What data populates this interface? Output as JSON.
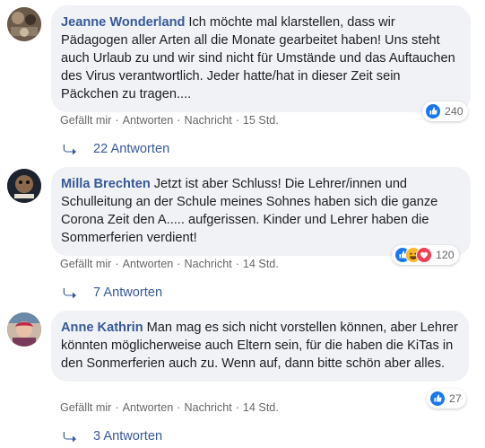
{
  "colors": {
    "author": "#385898",
    "bubble_bg": "#f0f2f5",
    "meta": "#65676b",
    "like_blue": "#1877f2",
    "haha_yellow": "#f7b928",
    "love_red": "#f33e58"
  },
  "comments": [
    {
      "author": "Jeanne Wonderland",
      "text": "Ich möchte mal klarstellen, dass wir Pädagogen aller Arten all die Monate gearbeitet haben! Uns steht auch Urlaub zu und wir sind nicht für Umstände und das Auftauchen des Virus verantwortlich. Jeder hatte/hat in dieser Zeit sein Päckchen zu tragen....",
      "actions": {
        "like": "Gefällt mir",
        "reply": "Antworten",
        "message": "Nachricht",
        "time": "15 Std."
      },
      "reactions": {
        "icons": [
          "like-icon"
        ],
        "count": "240"
      },
      "replies": "22 Antworten"
    },
    {
      "author": "Milla Brechten",
      "text": "Jetzt ist aber Schluss! Die Lehrer/innen und Schulleitung an der Schule meines Sohnes haben sich die ganze Corona Zeit den A..... aufgerissen. Kinder und Lehrer haben die Sommerferien verdient!",
      "actions": {
        "like": "Gefällt mir",
        "reply": "Antworten",
        "message": "Nachricht",
        "time": "14 Std."
      },
      "reactions": {
        "icons": [
          "like-icon",
          "haha-icon",
          "love-icon"
        ],
        "count": "120"
      },
      "replies": "7 Antworten"
    },
    {
      "author": "Anne Kathrin",
      "text": "Man mag es sich nicht vorstellen können, aber Lehrer könnten möglicherweise auch Eltern sein, für die haben die KiTas in den Sonmerferien auch zu. Wenn auf, dann bitte schön aber alles.",
      "actions": {
        "like": "Gefällt mir",
        "reply": "Antworten",
        "message": "Nachricht",
        "time": "14 Std."
      },
      "reactions": {
        "icons": [
          "like-icon"
        ],
        "count": "27"
      },
      "replies": "3 Antworten"
    }
  ]
}
